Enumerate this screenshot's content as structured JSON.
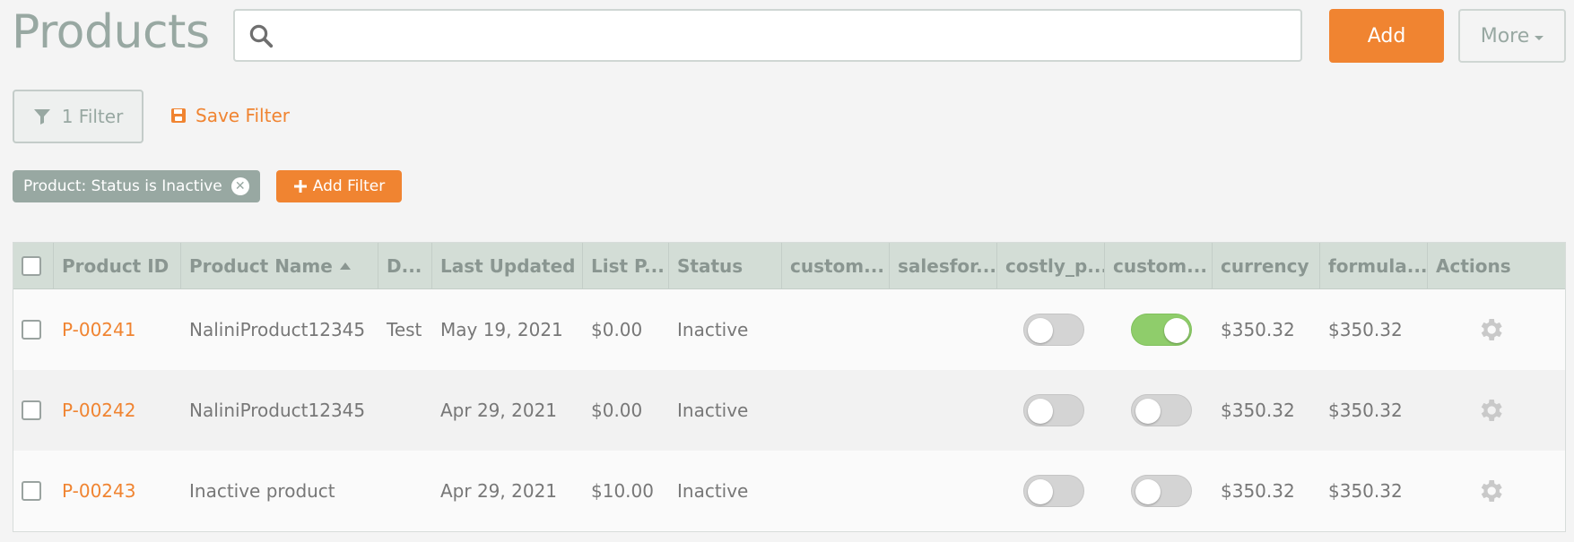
{
  "header": {
    "title": "Products",
    "search_placeholder": "",
    "add_label": "Add",
    "more_label": "More"
  },
  "filters": {
    "filter_button_label": "1 Filter",
    "save_filter_label": "Save Filter",
    "active_chip": "Product: Status is Inactive",
    "add_filter_label": "Add Filter"
  },
  "table": {
    "columns": {
      "product_id": "Product ID",
      "product_name": "Product Name",
      "d": "D...",
      "last_updated": "Last Updated",
      "list_price": "List P...",
      "status": "Status",
      "custom1": "custom...",
      "salesforce": "salesfor...",
      "costly": "costly_p...",
      "custom2": "custom...",
      "currency": "currency",
      "formula": "formula...",
      "actions": "Actions"
    },
    "rows": [
      {
        "id": "P-00241",
        "name": "NaliniProduct12345",
        "d": "Test",
        "updated": "May 19, 2021",
        "price": "$0.00",
        "status": "Inactive",
        "costly_on": false,
        "custom_on": true,
        "currency": "$350.32",
        "formula": "$350.32"
      },
      {
        "id": "P-00242",
        "name": "NaliniProduct12345",
        "d": "",
        "updated": "Apr 29, 2021",
        "price": "$0.00",
        "status": "Inactive",
        "costly_on": false,
        "custom_on": false,
        "currency": "$350.32",
        "formula": "$350.32"
      },
      {
        "id": "P-00243",
        "name": "Inactive product",
        "d": "",
        "updated": "Apr 29, 2021",
        "price": "$10.00",
        "status": "Inactive",
        "costly_on": false,
        "custom_on": false,
        "currency": "$350.32",
        "formula": "$350.32"
      }
    ]
  },
  "icons": {
    "search": "search-icon",
    "filter": "filter-icon",
    "save": "floppy-disk-icon",
    "plus": "plus-icon",
    "gear": "gear-icon"
  },
  "colors": {
    "accent": "#f08431",
    "muted": "#98a8a2",
    "toggle_on": "#8fcd6b",
    "header_bg": "#d3ddd6"
  }
}
